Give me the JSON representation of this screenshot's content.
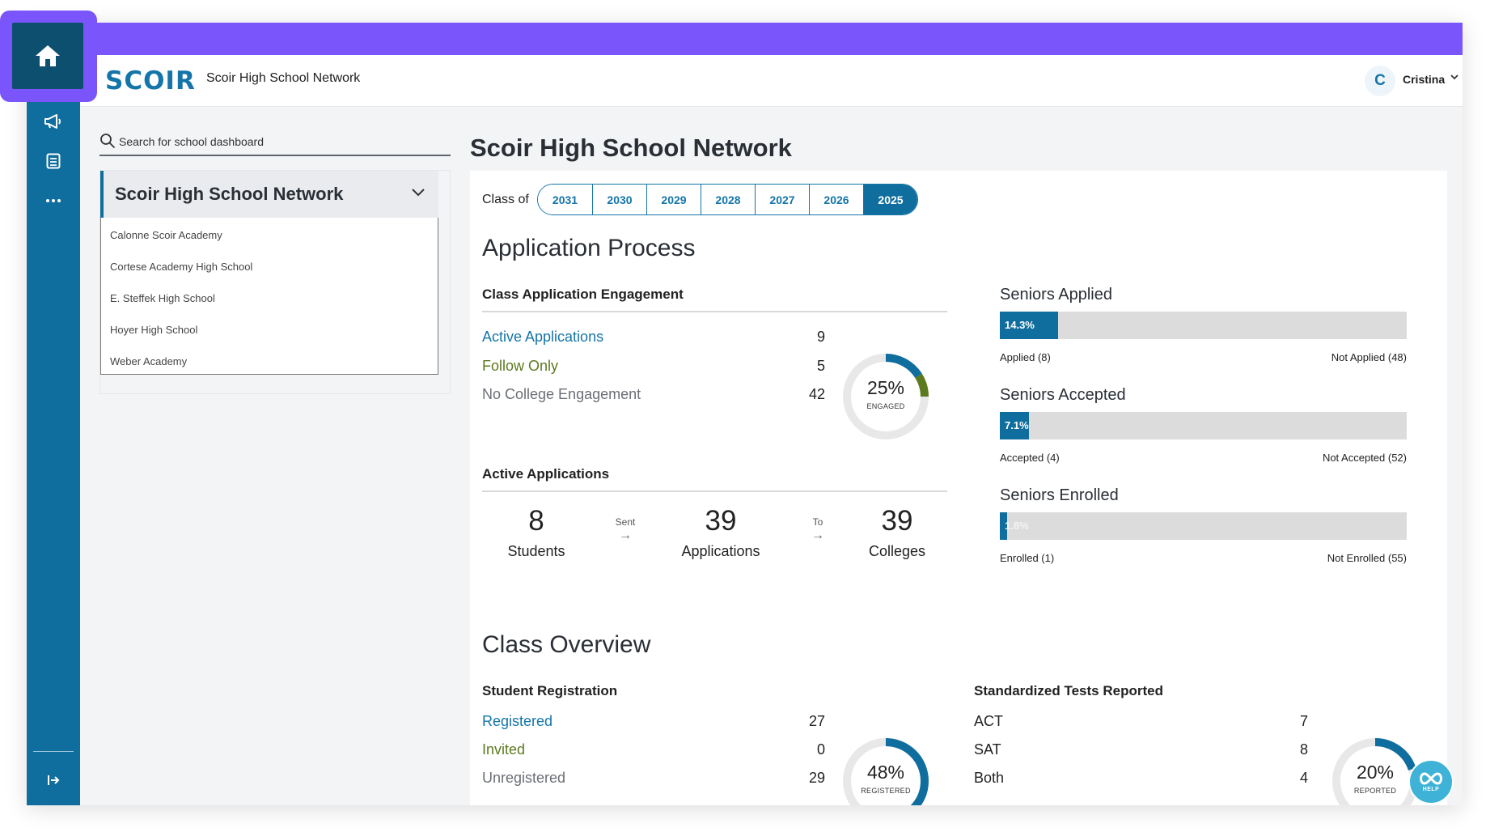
{
  "app": {
    "logo_text": "SCOIR",
    "header_title": "Scoir High School Network",
    "user_initial": "C",
    "user_name": "Cristina"
  },
  "colors": {
    "accent_purple": "#7a55fb",
    "sidebar_blue": "#0f6e9e",
    "link_blue": "#1475a8",
    "green": "#5b7a1d",
    "grey_text": "#6b6f76"
  },
  "sidebar": {
    "icons": [
      "home-icon",
      "megaphone-icon",
      "list-icon",
      "more-icon",
      "collapse-icon"
    ]
  },
  "search": {
    "placeholder": "Search for school dashboard",
    "value": ""
  },
  "school_selector": {
    "selected": "Scoir High School Network",
    "options": [
      "Calonne Scoir Academy",
      "Cortese Academy High School",
      "E. Steffek High School",
      "Hoyer High School",
      "Weber Academy"
    ]
  },
  "page_title": "Scoir High School Network",
  "class_of": {
    "label": "Class of",
    "years": [
      "2031",
      "2030",
      "2029",
      "2028",
      "2027",
      "2026",
      "2025"
    ],
    "selected": "2025"
  },
  "application_process": {
    "heading": "Application Process",
    "engagement": {
      "heading": "Class Application Engagement",
      "rows": [
        {
          "label": "Active Applications",
          "value": "9"
        },
        {
          "label": "Follow Only",
          "value": "5"
        },
        {
          "label": "No College Engagement",
          "value": "42"
        }
      ],
      "donut_percent": "25%",
      "donut_caption": "ENGAGED",
      "donut_fraction_blue": 0.16,
      "donut_fraction_green": 0.09
    },
    "active_applications": {
      "heading": "Active Applications",
      "students_value": "8",
      "students_label": "Students",
      "sent_label": "Sent",
      "applications_value": "39",
      "applications_label": "Applications",
      "to_label": "To",
      "colleges_value": "39",
      "colleges_label": "Colleges"
    },
    "seniors": [
      {
        "title": "Seniors Applied",
        "percent_text": "14.3%",
        "fraction": 0.143,
        "left_legend": "Applied (8)",
        "right_legend": "Not Applied (48)"
      },
      {
        "title": "Seniors Accepted",
        "percent_text": "7.1%",
        "fraction": 0.071,
        "left_legend": "Accepted (4)",
        "right_legend": "Not Accepted (52)"
      },
      {
        "title": "Seniors Enrolled",
        "percent_text": "1.8%",
        "fraction": 0.018,
        "left_legend": "Enrolled (1)",
        "right_legend": "Not Enrolled (55)"
      }
    ]
  },
  "class_overview": {
    "heading": "Class Overview",
    "registration": {
      "heading": "Student Registration",
      "rows": [
        {
          "label": "Registered",
          "value": "27"
        },
        {
          "label": "Invited",
          "value": "0"
        },
        {
          "label": "Unregistered",
          "value": "29"
        }
      ],
      "donut_percent": "48%",
      "donut_caption": "REGISTERED",
      "donut_fraction": 0.48
    },
    "tests": {
      "heading": "Standardized Tests Reported",
      "rows": [
        {
          "label": "ACT",
          "value": "7"
        },
        {
          "label": "SAT",
          "value": "8"
        },
        {
          "label": "Both",
          "value": "4"
        }
      ],
      "donut_percent": "20%",
      "donut_caption": "REPORTED",
      "donut_fraction": 0.2
    }
  },
  "help": {
    "label": "HELP"
  }
}
